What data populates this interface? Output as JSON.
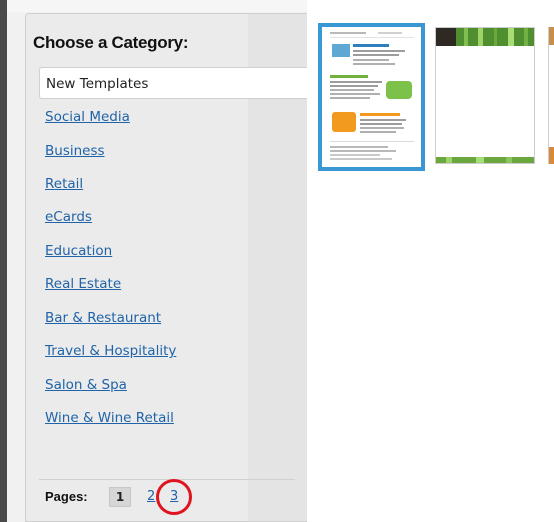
{
  "sidebar": {
    "title": "Choose a Category:",
    "selected_category": "New Templates",
    "categories": [
      "Social Media",
      "Business",
      "Retail",
      "eCards",
      "Education",
      "Real Estate",
      "Bar & Restaurant",
      "Travel & Hospitality",
      "Salon & Spa",
      "Wine & Wine Retail"
    ]
  },
  "pagination": {
    "label": "Pages:",
    "current": "1",
    "pages": [
      "2",
      "3"
    ]
  },
  "colors": {
    "link": "#1f63a8",
    "selected_thumb_border": "#3b97d3",
    "annotation_circle": "#e0141e"
  }
}
